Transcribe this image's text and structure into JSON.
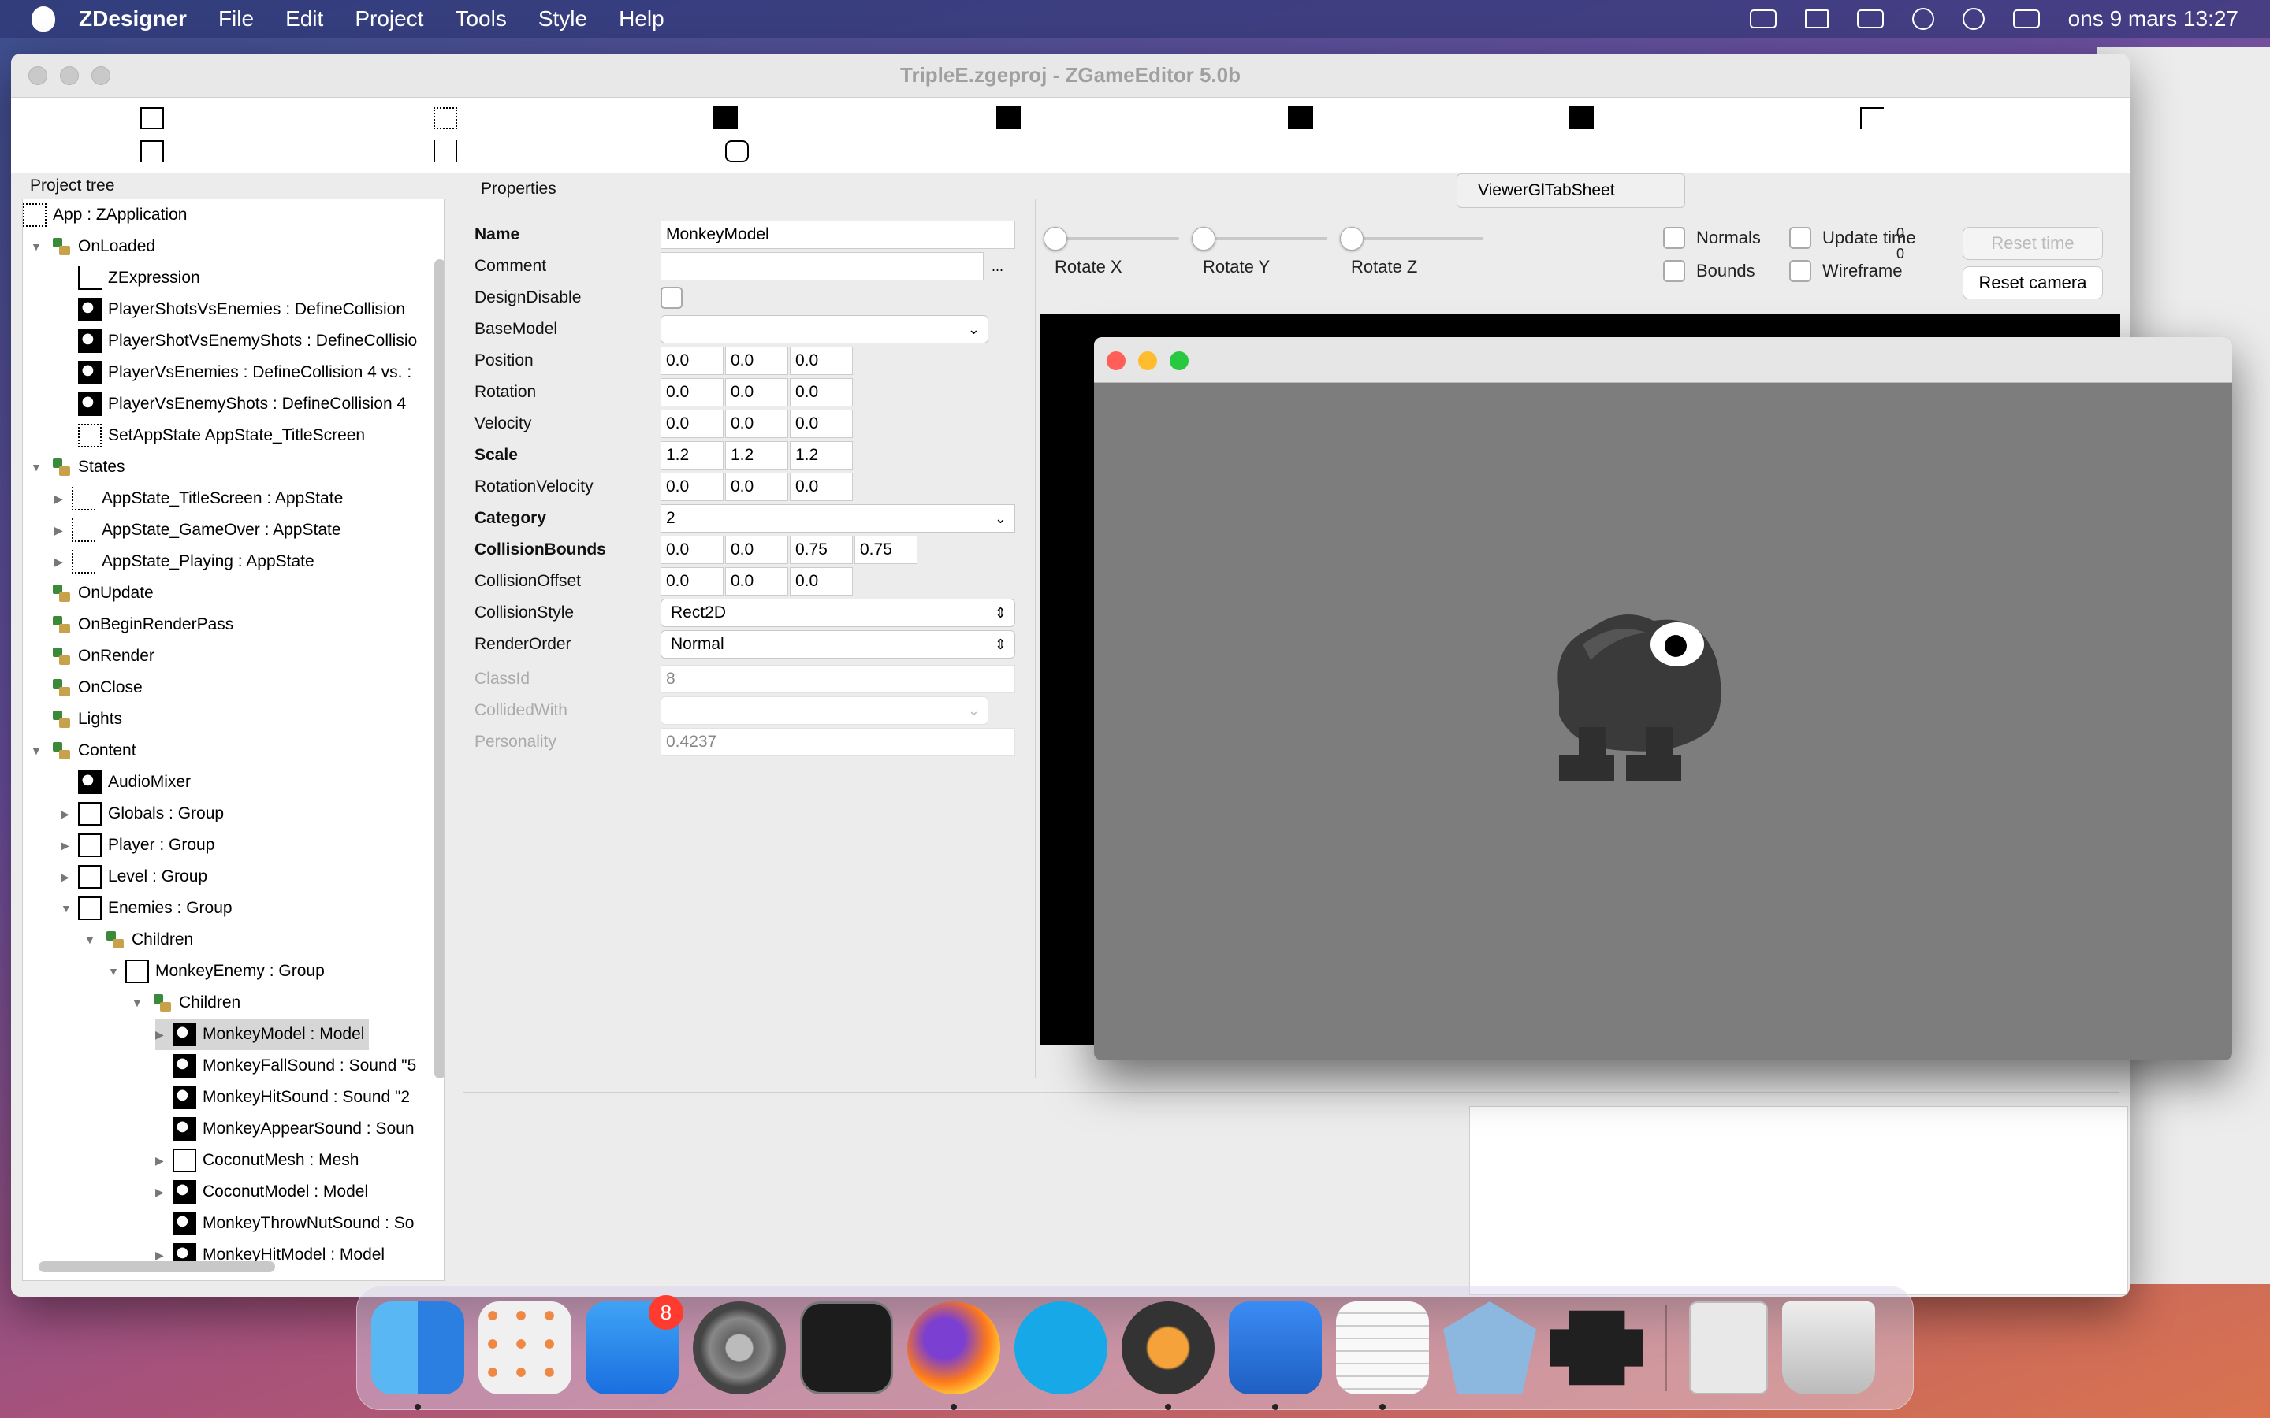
{
  "menubar": {
    "app_name": "ZDesigner",
    "menus": [
      "File",
      "Edit",
      "Project",
      "Tools",
      "Style",
      "Help"
    ],
    "datetime": "ons 9 mars  13:27"
  },
  "window": {
    "title": "TripleE.zgeproj - ZGameEditor 5.0b"
  },
  "project_tree": {
    "title": "Project tree",
    "rows": [
      {
        "label": "App : ZApplication"
      },
      {
        "label": "OnLoaded"
      },
      {
        "label": "ZExpression"
      },
      {
        "label": "PlayerShotsVsEnemies : DefineCollision"
      },
      {
        "label": "PlayerShotVsEnemyShots : DefineCollisio"
      },
      {
        "label": "PlayerVsEnemies : DefineCollision  4 vs. :"
      },
      {
        "label": "PlayerVsEnemyShots : DefineCollision  4"
      },
      {
        "label": "SetAppState  AppState_TitleScreen"
      },
      {
        "label": "States"
      },
      {
        "label": "AppState_TitleScreen : AppState"
      },
      {
        "label": "AppState_GameOver : AppState"
      },
      {
        "label": "AppState_Playing : AppState"
      },
      {
        "label": "OnUpdate"
      },
      {
        "label": "OnBeginRenderPass"
      },
      {
        "label": "OnRender"
      },
      {
        "label": "OnClose"
      },
      {
        "label": "Lights"
      },
      {
        "label": "Content"
      },
      {
        "label": "AudioMixer"
      },
      {
        "label": "Globals : Group"
      },
      {
        "label": "Player : Group"
      },
      {
        "label": "Level : Group"
      },
      {
        "label": "Enemies : Group"
      },
      {
        "label": "Children"
      },
      {
        "label": "MonkeyEnemy : Group"
      },
      {
        "label": "Children"
      },
      {
        "label": "MonkeyModel : Model"
      },
      {
        "label": "MonkeyFallSound : Sound \"5"
      },
      {
        "label": "MonkeyHitSound : Sound \"2"
      },
      {
        "label": "MonkeyAppearSound : Soun"
      },
      {
        "label": "CoconutMesh : Mesh"
      },
      {
        "label": "CoconutModel : Model"
      },
      {
        "label": "MonkeyThrowNutSound : So"
      },
      {
        "label": "MonkeyHitModel : Model"
      }
    ]
  },
  "properties": {
    "title": "Properties",
    "name_label": "Name",
    "name_value": "MonkeyModel",
    "comment_label": "Comment",
    "comment_value": "",
    "comment_button": "...",
    "designdisable_label": "DesignDisable",
    "basemodel_label": "BaseModel",
    "position_label": "Position",
    "position": [
      "0.0",
      "0.0",
      "0.0"
    ],
    "rotation_label": "Rotation",
    "rotation": [
      "0.0",
      "0.0",
      "0.0"
    ],
    "velocity_label": "Velocity",
    "velocity": [
      "0.0",
      "0.0",
      "0.0"
    ],
    "scale_label": "Scale",
    "scale": [
      "1.2",
      "1.2",
      "1.2"
    ],
    "rotvel_label": "RotationVelocity",
    "rotvel": [
      "0.0",
      "0.0",
      "0.0"
    ],
    "category_label": "Category",
    "category_value": "2",
    "collbounds_label": "CollisionBounds",
    "collbounds": [
      "0.0",
      "0.0",
      "0.75",
      "0.75"
    ],
    "colloffset_label": "CollisionOffset",
    "colloffset": [
      "0.0",
      "0.0",
      "0.0"
    ],
    "collstyle_label": "CollisionStyle",
    "collstyle_value": "Rect2D",
    "renderorder_label": "RenderOrder",
    "renderorder_value": "Normal",
    "classid_label": "ClassId",
    "classid_value": "8",
    "collidedwith_label": "CollidedWith",
    "personality_label": "Personality",
    "personality_value": "0.4237"
  },
  "viewer": {
    "tab_label": "ViewerGlTabSheet",
    "rotate_x": "Rotate X",
    "rotate_y": "Rotate Y",
    "rotate_z": "Rotate Z",
    "normals": "Normals",
    "bounds": "Bounds",
    "update_time": "Update time",
    "wireframe": "Wireframe",
    "counter_a": "0",
    "counter_b": "0",
    "reset_time": "Reset time",
    "reset_camera": "Reset camera"
  },
  "dock": {
    "appstore_badge": "8"
  },
  "colors": {
    "close": "#ff5f57",
    "minimize": "#febc2e",
    "zoom": "#28c840"
  }
}
